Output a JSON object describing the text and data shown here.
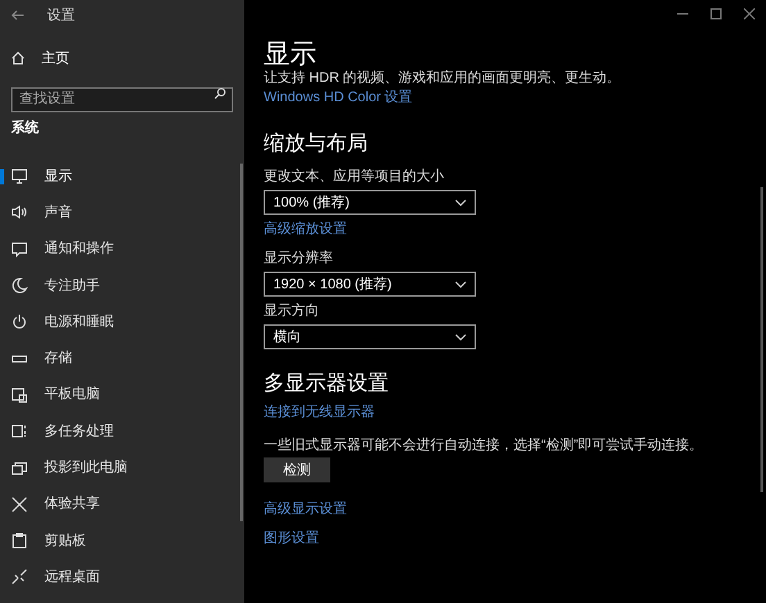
{
  "window": {
    "title": "设置"
  },
  "sidebar": {
    "home": "主页",
    "search": {
      "placeholder": "查找设置"
    },
    "section": "系统",
    "items": [
      {
        "label": "显示",
        "selected": true
      },
      {
        "label": "声音",
        "selected": false
      },
      {
        "label": "通知和操作",
        "selected": false
      },
      {
        "label": "专注助手",
        "selected": false
      },
      {
        "label": "电源和睡眠",
        "selected": false
      },
      {
        "label": "存储",
        "selected": false
      },
      {
        "label": "平板电脑",
        "selected": false
      },
      {
        "label": "多任务处理",
        "selected": false
      },
      {
        "label": "投影到此电脑",
        "selected": false
      },
      {
        "label": "体验共享",
        "selected": false
      },
      {
        "label": "剪贴板",
        "selected": false
      },
      {
        "label": "远程桌面",
        "selected": false
      }
    ]
  },
  "main": {
    "title": "显示",
    "blocks": [
      {
        "kind": "text",
        "text": "让支持 HDR 的视频、游戏和应用的画面更明亮、更生动。"
      },
      {
        "kind": "link",
        "text": "Windows HD Color 设置"
      },
      {
        "kind": "heading",
        "text": "缩放与布局"
      },
      {
        "kind": "label",
        "text": "更改文本、应用等项目的大小"
      },
      {
        "kind": "dropdown",
        "text": "100% (推荐)"
      },
      {
        "kind": "link",
        "text": "高级缩放设置"
      },
      {
        "kind": "label",
        "text": "显示分辨率"
      },
      {
        "kind": "dropdown",
        "text": "1920 × 1080 (推荐)"
      },
      {
        "kind": "label",
        "text": "显示方向"
      },
      {
        "kind": "dropdown",
        "text": "横向"
      },
      {
        "kind": "heading",
        "text": "多显示器设置"
      },
      {
        "kind": "link",
        "text": "连接到无线显示器"
      },
      {
        "kind": "text",
        "text": "一些旧式显示器可能不会进行自动连接，选择“检测”即可尝试手动连接。"
      },
      {
        "kind": "button",
        "text": "检测"
      },
      {
        "kind": "link",
        "text": "高级显示设置"
      },
      {
        "kind": "link",
        "text": "图形设置"
      }
    ]
  }
}
